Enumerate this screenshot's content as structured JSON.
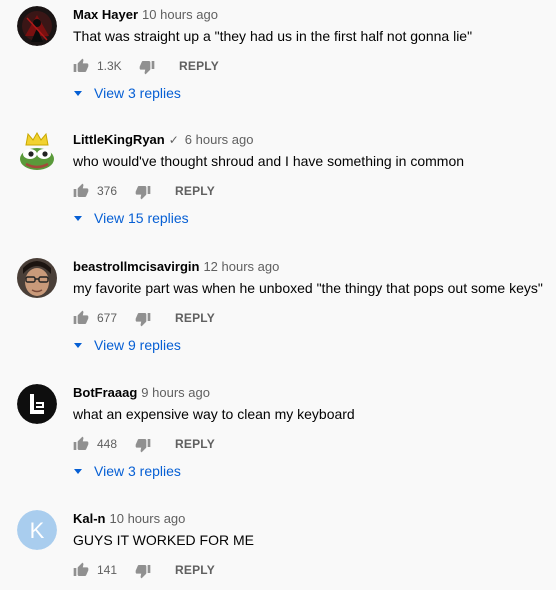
{
  "comments": [
    {
      "author": "Max Hayer",
      "verified": false,
      "time": "10 hours ago",
      "text": "That was straight up a \"they had us in the first half not gonna lie\"",
      "likes": "1.3K",
      "reply_label": "REPLY",
      "view_replies": "View 3 replies",
      "avatar_icon": "dark-figure-avatar"
    },
    {
      "author": "LittleKingRyan",
      "verified": true,
      "verified_mark": "✓",
      "time": "6 hours ago",
      "text": "who would've thought shroud and I have something in common",
      "likes": "376",
      "reply_label": "REPLY",
      "view_replies": "View 15 replies",
      "avatar_icon": "crowned-frog-avatar"
    },
    {
      "author": "beastrollmcisavirgin",
      "verified": false,
      "time": "12 hours ago",
      "text": "my favorite part was when he unboxed \"the thingy that pops out some keys\"",
      "likes": "677",
      "reply_label": "REPLY",
      "view_replies": "View 9 replies",
      "avatar_icon": "face-photo-avatar"
    },
    {
      "author": "BotFraaag",
      "verified": false,
      "time": "9 hours ago",
      "text": "what an expensive way to clean my keyboard",
      "likes": "448",
      "reply_label": "REPLY",
      "view_replies": "View 3 replies",
      "avatar_icon": "l-logo-avatar"
    },
    {
      "author": "Kal-n",
      "verified": false,
      "time": "10 hours ago",
      "text": "GUYS IT WORKED FOR ME",
      "likes": "141",
      "reply_label": "REPLY",
      "avatar_icon": "letter-k-avatar",
      "avatar_letter": "K"
    }
  ],
  "colors": {
    "background": "#f9f9f9",
    "link_blue": "#065fd4",
    "secondary_text": "#606060"
  }
}
